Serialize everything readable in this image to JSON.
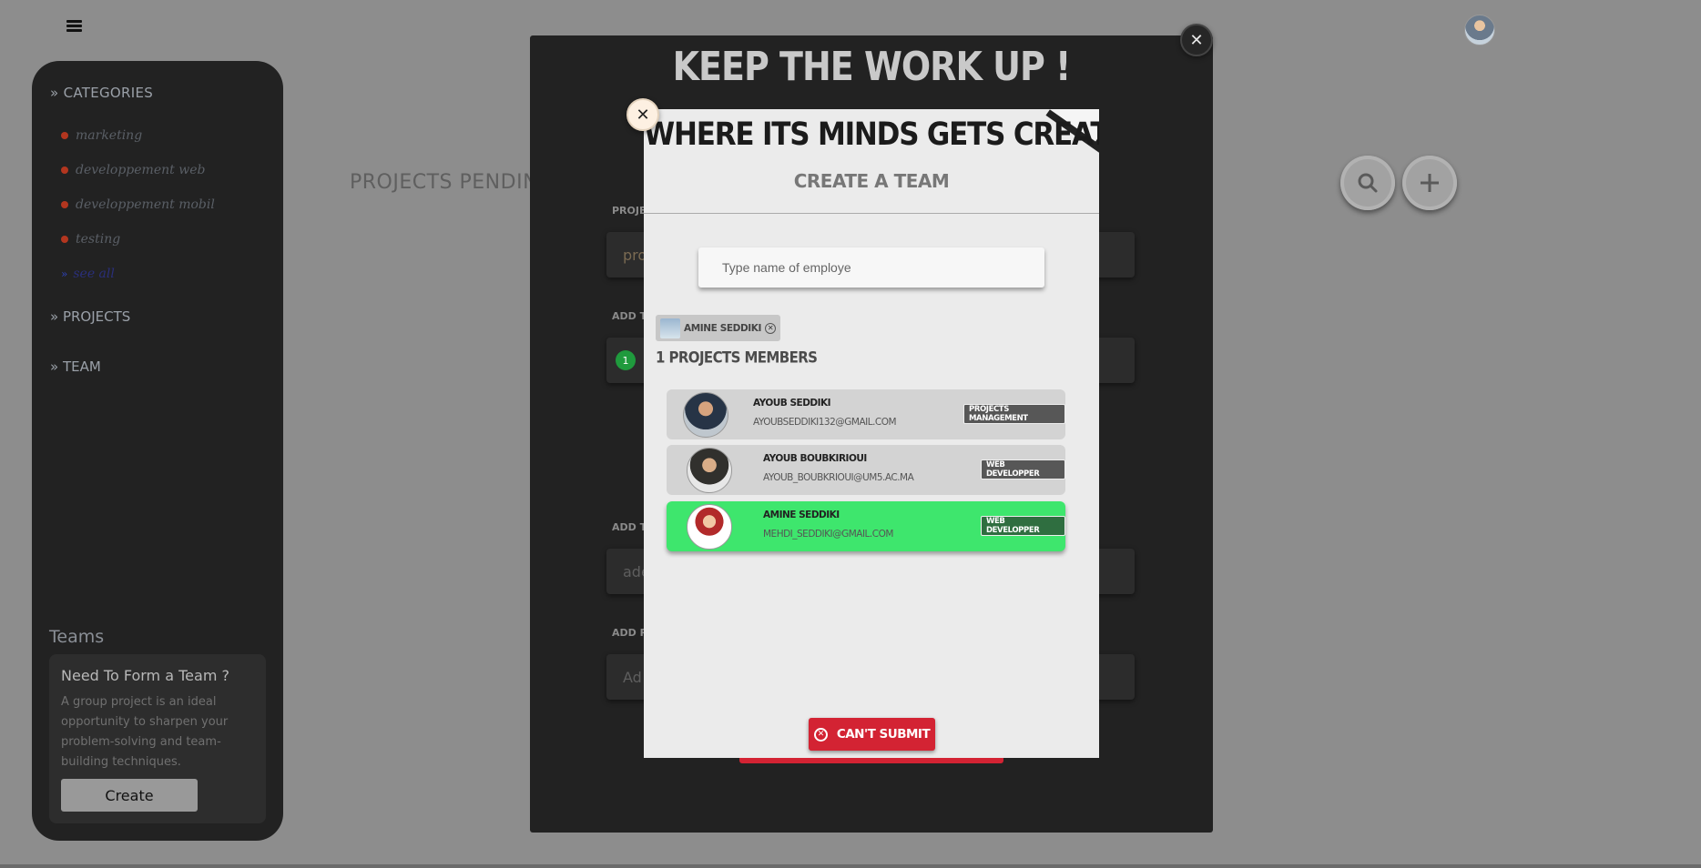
{
  "sidebar": {
    "categories_heading": "CATEGORIES",
    "categories": [
      "marketing",
      "developpement web",
      "developpement mobil",
      "testing"
    ],
    "more_label": "see all",
    "projects_heading": "PROJECTS",
    "team_heading": "TEAM",
    "teams_title": "Teams",
    "team_card": {
      "title": "Need To Form a Team ?",
      "text": "A group project is an ideal opportunity to sharpen your problem-solving and team-building techniques.",
      "button": "Create"
    }
  },
  "background": {
    "page_title": "PROJECTS PENDIN",
    "search_icon": "search-icon",
    "add_icon": "plus-icon"
  },
  "project_modal": {
    "title": "KEEP THE WORK UP !",
    "project_label": "PROJECT NAME",
    "project_value": "proje",
    "add_team_label": "ADD TE",
    "team_count": "1",
    "add_task_label": "ADD TA",
    "task_placeholder": "ade",
    "add_resources_label": "ADD RE",
    "resources_placeholder": "Ad"
  },
  "team_modal": {
    "title": "WHERE ITS MINDS GETS CREATIVE!",
    "subtitle": "CREATE A TEAM",
    "search_placeholder": "Type name of employe",
    "selected_chip": "AMINE SEDDIKI",
    "members_count": "1 PROJECTS MEMBERS",
    "members": [
      {
        "name": "AYOUB SEDDIKI",
        "email": "AYOUBSEDDIKI132@GMAIL.COM",
        "role": "PROJECTS MANAGEMENT",
        "selected": false
      },
      {
        "name": "AYOUB BOUBKIRIOUI",
        "email": "AYOUB_BOUBKRIOUI@UM5.AC.MA",
        "role": "WEB DEVELOPPER",
        "selected": false
      },
      {
        "name": "AMINE SEDDIKI",
        "email": "MEHDI_SEDDIKI@GMAIL.COM",
        "role": "WEB DEVELOPPER",
        "selected": true
      }
    ],
    "submit_label": "CAN'T SUBMIT"
  },
  "colors": {
    "backdrop": "#8d8d8d",
    "danger": "#d32333",
    "selected_member": "#3ee66d",
    "category_dot": "#b3361f"
  }
}
